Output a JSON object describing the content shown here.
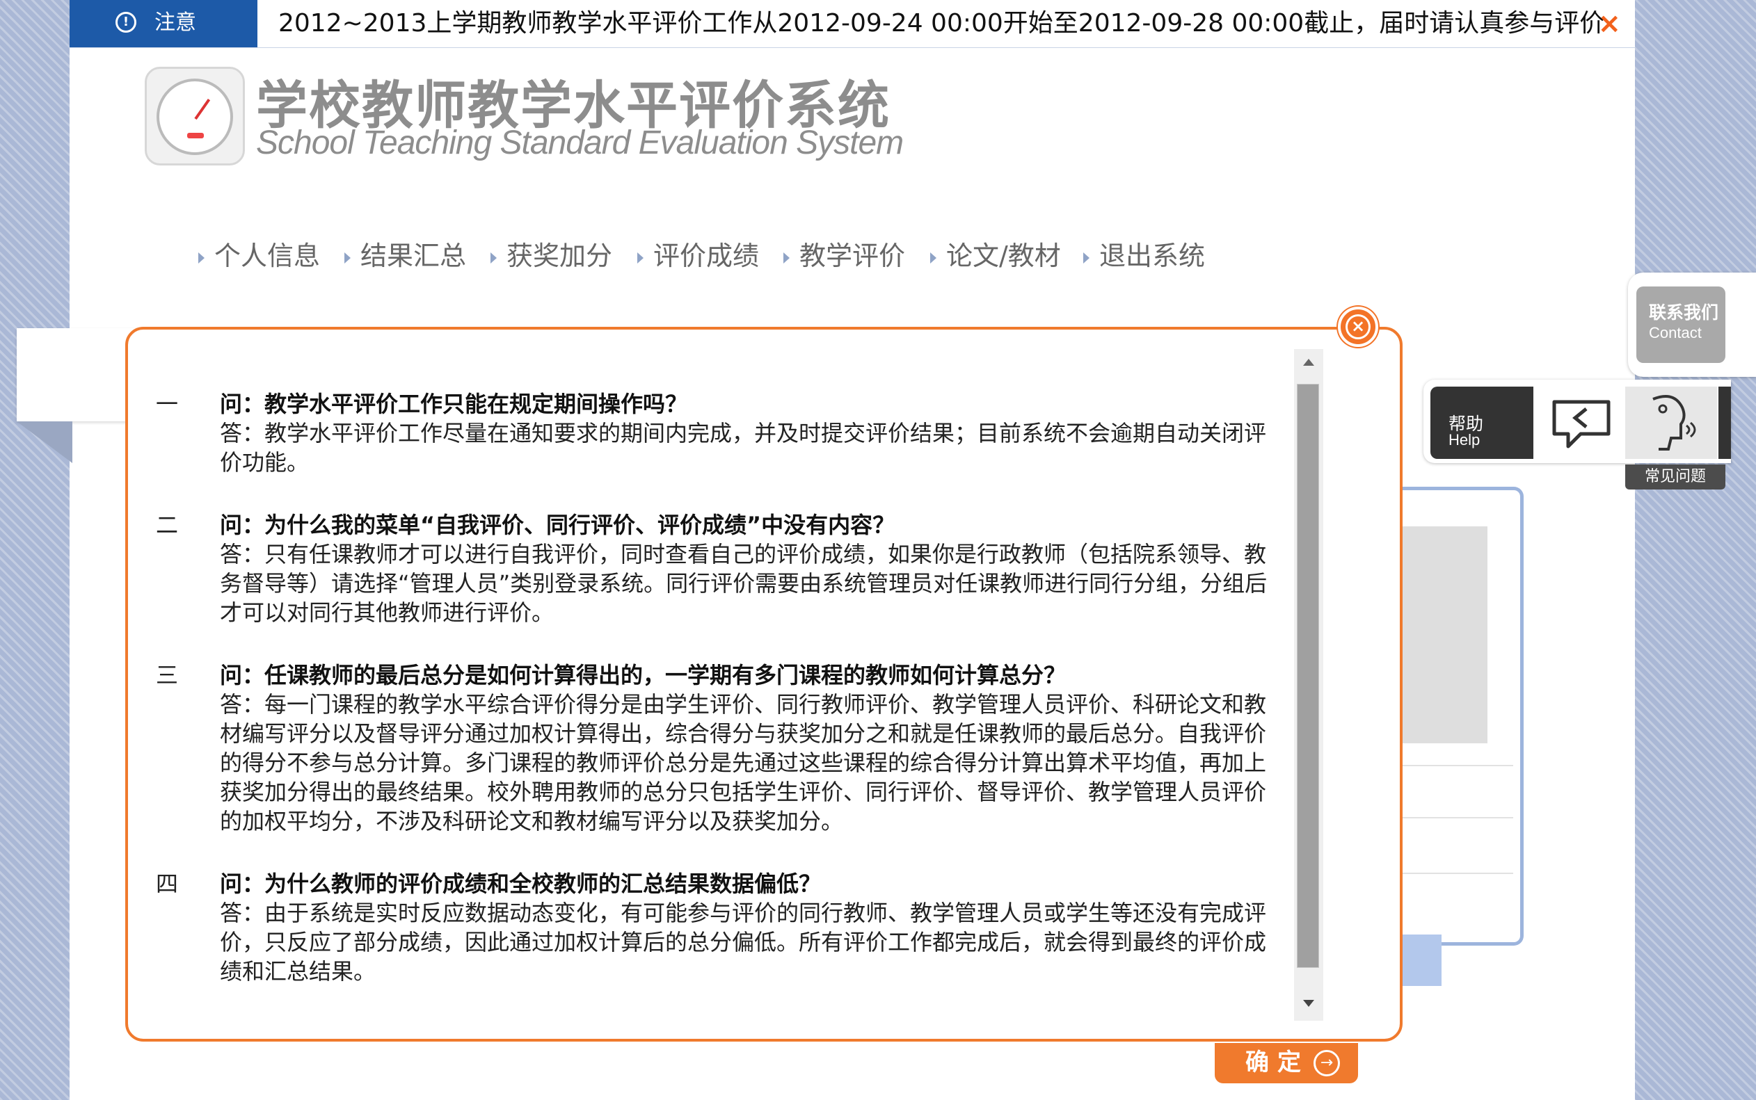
{
  "notice": {
    "label": "注意",
    "text": "2012~2013上学期教师教学水平评价工作从2012-09-24 00:00开始至2012-09-28 00:00截止，届时请认真参与评价",
    "close_glyph": "×"
  },
  "header": {
    "title_cn": "学校教师教学水平评价系统",
    "title_en": "School Teaching Standard Evaluation System"
  },
  "nav": {
    "items": [
      {
        "label": "个人信息"
      },
      {
        "label": "结果汇总"
      },
      {
        "label": "获奖加分"
      },
      {
        "label": "评价成绩"
      },
      {
        "label": "教学评价"
      },
      {
        "label": "论文/教材"
      },
      {
        "label": "退出系统"
      }
    ]
  },
  "contact": {
    "label_cn": "联系我们",
    "label_en": "Contact"
  },
  "help": {
    "label_cn": "帮助",
    "label_en": "Help",
    "faq_label": "常见问题"
  },
  "faq": [
    {
      "num": "一",
      "question": "问：教学水平评价工作只能在规定期间操作吗？",
      "answer": "答：教学水平评价工作尽量在通知要求的期间内完成，并及时提交评价结果；目前系统不会逾期自动关闭评价功能。"
    },
    {
      "num": "二",
      "question": "问：为什么我的菜单“自我评价、同行评价、评价成绩”中没有内容？",
      "answer": "答：只有任课教师才可以进行自我评价，同时查看自己的评价成绩，如果你是行政教师（包括院系领导、教务督导等）请选择“管理人员”类别登录系统。同行评价需要由系统管理员对任课教师进行同行分组，分组后才可以对同行其他教师进行评价。"
    },
    {
      "num": "三",
      "question": "问：任课教师的最后总分是如何计算得出的，一学期有多门课程的教师如何计算总分？",
      "answer": "答：每一门课程的教学水平综合评价得分是由学生评价、同行教师评价、教学管理人员评价、科研论文和教材编写评分以及督导评分通过加权计算得出，综合得分与获奖加分之和就是任课教师的最后总分。自我评价的得分不参与总分计算。多门课程的教师评价总分是先通过这些课程的综合得分计算出算术平均值，再加上获奖加分得出的最终结果。校外聘用教师的总分只包括学生评价、同行评价、督导评价、教学管理人员评价的加权平均分，不涉及科研论文和教材编写评分以及获奖加分。"
    },
    {
      "num": "四",
      "question": "问：为什么教师的评价成绩和全校教师的汇总结果数据偏低？",
      "answer": "答：由于系统是实时反应数据动态变化，有可能参与评价的同行教师、教学管理人员或学生等还没有完成评价，只反应了部分成绩，因此通过加权计算后的总分偏低。所有评价工作都完成后，就会得到最终的评价成绩和汇总结果。"
    }
  ],
  "modal": {
    "confirm_label": "确定",
    "confirm_glyph": "→",
    "close_glyph": "×"
  },
  "colors": {
    "accent": "#f07a2d",
    "notice_blue": "#1d5aa8",
    "background": "#aab8d6"
  }
}
